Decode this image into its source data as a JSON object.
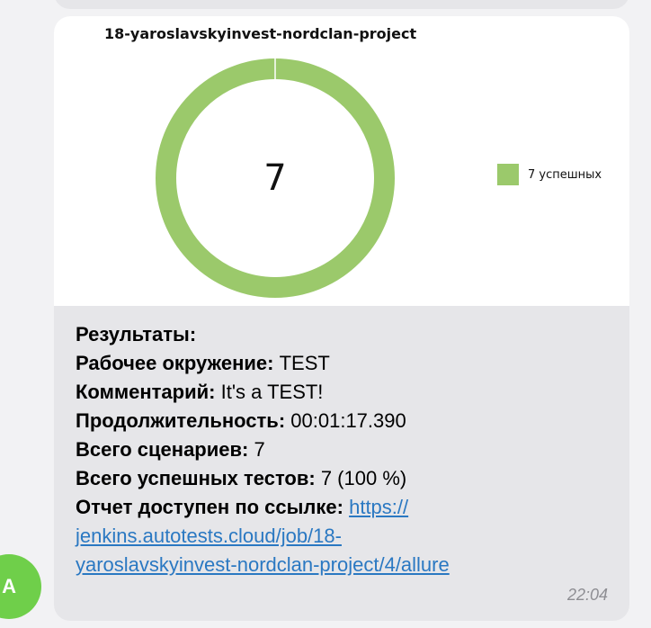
{
  "chart_data": {
    "type": "pie",
    "title": "18-yaroslavskyinvest-nordclan-project",
    "center_label": "7",
    "categories": [
      "7 успешных"
    ],
    "values": [
      7
    ],
    "colors": [
      "#9bc96b"
    ],
    "legend_position": "right"
  },
  "results": {
    "heading": "Результаты:",
    "env_label": "Рабочее окружение:",
    "env_value": " TEST",
    "comment_label": "Комментарий:",
    "comment_value": " It's a TEST!",
    "duration_label": "Продолжительность:",
    "duration_value": " 00:01:17.390",
    "scenarios_label": "Всего сценариев:",
    "scenarios_value": " 7",
    "passed_label": "Всего успешных тестов:",
    "passed_value": " 7 (100 %)",
    "report_label": "Отчет доступен по ссылке:",
    "link_part1": "https://",
    "link_part2": "jenkins.autotests.cloud/job/18-",
    "link_part3": "yaroslavskyinvest-nordclan-project/4/allure"
  },
  "message": {
    "time": "22:04"
  },
  "avatar": {
    "initial": "A",
    "color": "#6fcf4a"
  }
}
